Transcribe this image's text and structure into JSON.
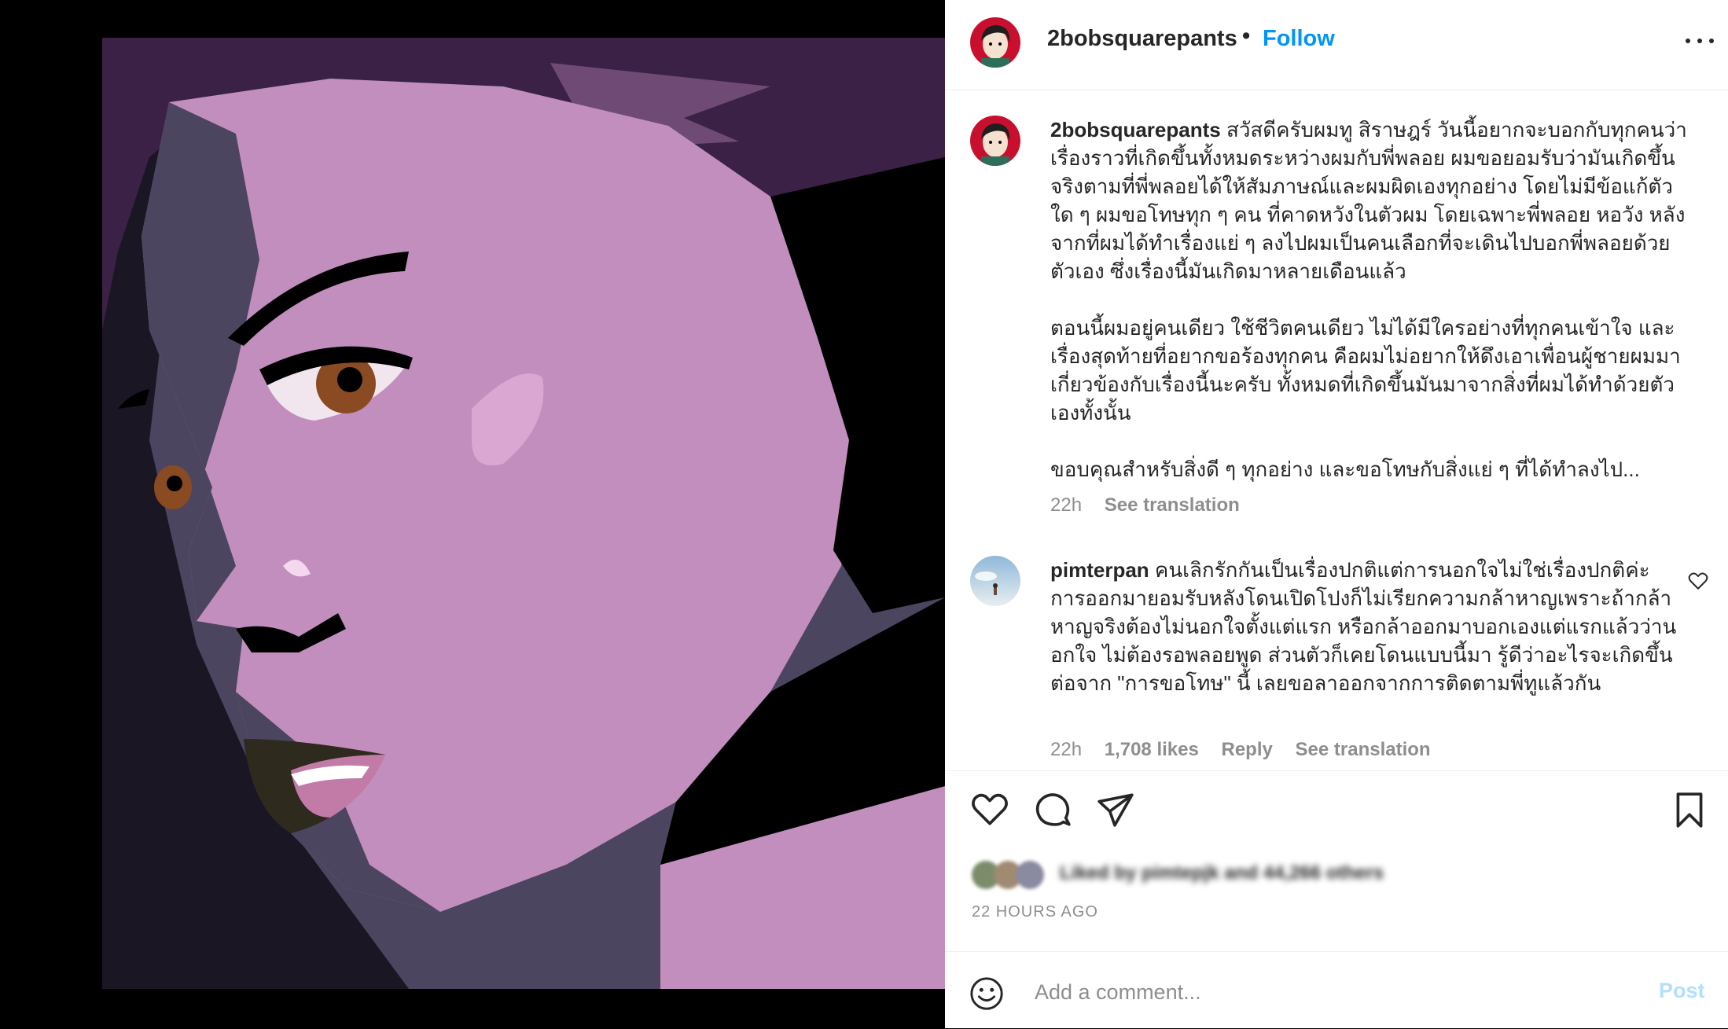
{
  "post": {
    "username": "2bobsquarepants",
    "dot": "•",
    "follow_label": "Follow",
    "more_icon": "more-horizontal-icon"
  },
  "caption": {
    "username": "2bobsquarepants",
    "paragraphs": [
      "สวัสดีครับผมทู สิราษฎร์ วันนี้อยากจะบอกกับทุกคนว่าเรื่องราวที่เกิดขึ้นทั้งหมดระหว่างผมกับพี่พลอย ผมขอยอมรับว่ามันเกิดขึ้นจริงตามที่พี่พลอยได้ให้สัมภาษณ์และผมผิดเองทุกอย่าง โดยไม่มีข้อแก้ตัวใด ๆ ผมขอโทษทุก ๆ คน ที่คาดหวังในตัวผม โดยเฉพาะพี่พลอย หอวัง หลังจากที่ผมได้ทำเรื่องแย่ ๆ ลงไปผมเป็นคนเลือกที่จะเดินไปบอกพี่พลอยด้วยตัวเอง ซึ่งเรื่องนี้มันเกิดมาหลายเดือนแล้ว",
      "ตอนนี้ผมอยู่คนเดียว ใช้ชีวิตคนเดียว ไม่ได้มีใครอย่างที่ทุกคนเข้าใจ และเรื่องสุดท้ายที่อยากขอร้องทุกคน คือผมไม่อยากให้ดึงเอาเพื่อนผู้ชายผมมาเกี่ยวข้องกับเรื่องนี้นะครับ ทั้งหมดที่เกิดขึ้นมันมาจากสิ่งที่ผมได้ทำด้วยตัวเองทั้งนั้น",
      "ขอบคุณสำหรับสิ่งดี ๆ ทุกอย่าง และขอโทษกับสิ่งแย่ ๆ ที่ได้ทำลงไป..."
    ],
    "time": "22h",
    "see_translation": "See translation"
  },
  "comment": {
    "username": "pimterpan",
    "text": "คนเลิกรักกันเป็นเรื่องปกติแต่การนอกใจไม่ใช่เรื่องปกติค่ะ การออกมายอมรับหลังโดนเปิดโปงก็ไม่เรียกความกล้าหาญเพราะถ้ากล้าหาญจริงต้องไม่นอกใจตั้งแต่แรก หรือกล้าออกมาบอกเองแต่แรกแล้วว่านอกใจ ไม่ต้องรอพลอยพูด ส่วนตัวก็เคยโดนแบบนี้มา รู้ดีว่าอะไรจะเกิดขึ้นต่อจาก \"การขอโทษ\" นี้ เลยขอลาออกจากการติดตามพี่ทูแล้วกัน",
    "time": "22h",
    "likes": "1,708 likes",
    "reply": "Reply",
    "see_translation": "See translation",
    "like_icon": "heart-outline-icon"
  },
  "actions": {
    "icons": [
      "heart-icon",
      "comment-icon",
      "share-icon",
      "bookmark-icon"
    ],
    "likes_text": "Liked by pimtepjk and 44,266 others",
    "timestamp": "22 HOURS AGO"
  },
  "add_comment": {
    "placeholder": "Add a comment...",
    "post_label": "Post",
    "emoji_icon": "emoji-icon"
  },
  "colors": {
    "link_blue": "#0095f6",
    "post_disabled": "#b2dffc",
    "muted": "#8e8e8e",
    "text": "#262626",
    "skin": "#c28ebd",
    "hair": "#3a1f40"
  }
}
